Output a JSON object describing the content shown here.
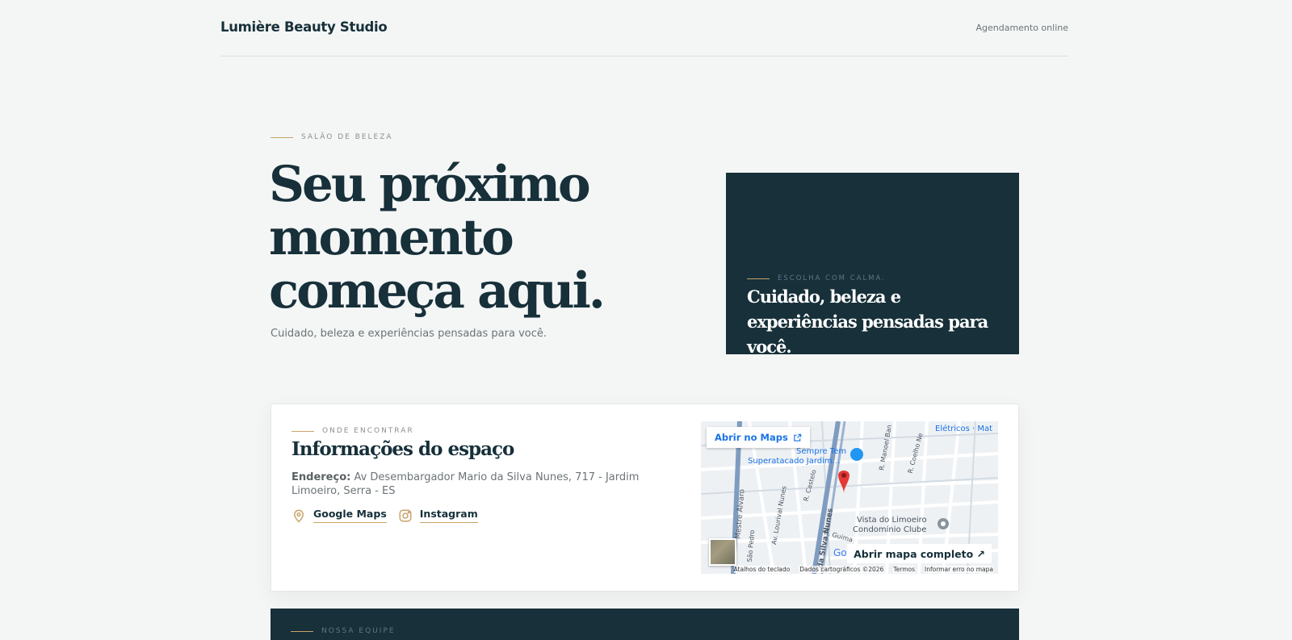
{
  "header": {
    "brand": "Lumière Beauty Studio",
    "nav_link": "Agendamento online"
  },
  "hero": {
    "eyebrow": "SALÃO DE BELEZA",
    "title": "Seu próximo momento começa aqui.",
    "subtitle": "Cuidado, beleza e experiências pensadas para você.",
    "card": {
      "eyebrow": "ESCOLHA COM CALMA.",
      "title": "Cuidado, beleza e experiências pensadas para você."
    }
  },
  "info": {
    "eyebrow": "ONDE ENCONTRAR",
    "title": "Informações do espaço",
    "address_label": "Endereço:",
    "address_value": "Av Desembargador Mario da Silva Nunes, 717 - Jardim Limoeiro, Serra - ES",
    "links": [
      {
        "label": "Google Maps",
        "icon": "map-pin-icon"
      },
      {
        "label": "Instagram",
        "icon": "instagram-icon"
      }
    ],
    "map": {
      "open_button": "Abrir no Maps",
      "full_button": "Abrir mapa completo ↗",
      "labels": {
        "poi_1": "Sempre Tem",
        "poi_2": "Superatacado Jardim...",
        "poi_3": "Elétricos · Mat",
        "club_1": "Vista do Limoeiro",
        "club_2": "Condomínio Clube",
        "street_1": "Mestre Álvaro",
        "street_2": "Av. Lourival Nunes",
        "street_3": "R. Castelo",
        "street_4": "R. Manoel Ban",
        "street_5": "R. Coelho Ne",
        "street_6": "São Pedro",
        "street_7": "da Silva Nunes",
        "street_8": "R. Guima"
      },
      "footer": [
        "Atalhos do teclado",
        "Dados cartográficos ©2026",
        "Termos",
        "Informar erro no mapa"
      ],
      "google_logo": "Google"
    }
  },
  "team": {
    "eyebrow": "NOSSA EQUIPE"
  },
  "colors": {
    "primary": "#17303a",
    "accent": "#c9a46a",
    "background": "#f4f6f5",
    "muted": "#6b7477",
    "map_link": "#1a73e8",
    "pin": "#e53935"
  }
}
